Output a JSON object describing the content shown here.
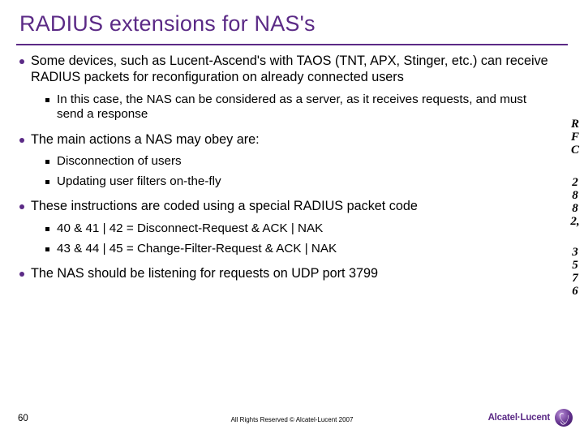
{
  "title": "RADIUS extensions for NAS's",
  "bullets": [
    {
      "text": "Some devices, such as Lucent-Ascend's with TAOS (TNT, APX, Stinger, etc.) can receive RADIUS packets for reconfiguration on already connected users",
      "sub": [
        "In this case, the NAS can be considered as a server, as it receives requests, and must send a response"
      ]
    },
    {
      "text": "The main actions a NAS may obey are:",
      "sub": [
        "Disconnection of users",
        "Updating user filters on-the-fly"
      ]
    },
    {
      "text": "These instructions are coded using a special RADIUS packet code",
      "sub": [
        "40 & 41 | 42  = Disconnect-Request & ACK | NAK",
        "43 & 44 | 45  = Change-Filter-Request & ACK | NAK"
      ]
    },
    {
      "text": "The NAS should be listening for requests on UDP port 3799",
      "sub": []
    }
  ],
  "sidecol": {
    "g1": [
      "R",
      "F",
      "C"
    ],
    "g2": [
      "2",
      "8",
      "8",
      "2,"
    ],
    "g3": [
      "3",
      "5",
      "7",
      "6"
    ]
  },
  "footer": {
    "page": "60",
    "copyright": "All Rights Reserved © Alcatel-Lucent 2007",
    "brand": "Alcatel·Lucent"
  }
}
